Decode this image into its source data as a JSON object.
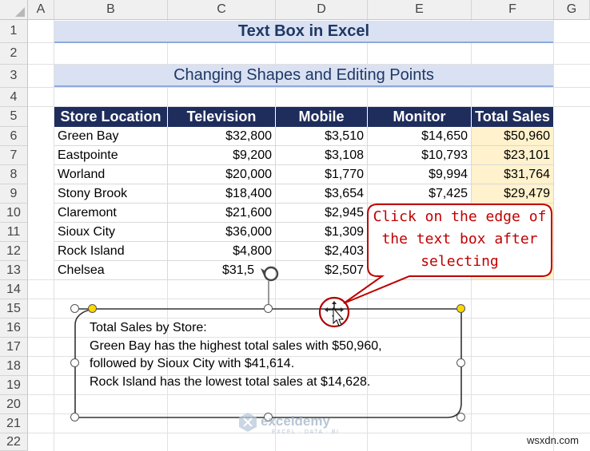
{
  "columns": [
    "A",
    "B",
    "C",
    "D",
    "E",
    "F",
    "G"
  ],
  "rows": [
    "1",
    "2",
    "3",
    "4",
    "5",
    "6",
    "7",
    "8",
    "9",
    "10",
    "11",
    "12",
    "13",
    "14",
    "15",
    "16",
    "17",
    "18",
    "19",
    "20",
    "21",
    "22"
  ],
  "title": "Text Box in Excel",
  "subtitle": "Changing Shapes and Editing Points",
  "table": {
    "headers": [
      "Store Location",
      "Television",
      "Mobile",
      "Monitor",
      "Total Sales"
    ],
    "rows": [
      [
        "Green Bay",
        "$32,800",
        "$3,510",
        "$14,650",
        "$50,960"
      ],
      [
        "Eastpointe",
        "$9,200",
        "$3,108",
        "$10,793",
        "$23,101"
      ],
      [
        "Worland",
        "$20,000",
        "$1,770",
        "$9,994",
        "$31,764"
      ],
      [
        "Stony Brook",
        "$18,400",
        "$3,654",
        "$7,425",
        "$29,479"
      ],
      [
        "Claremont",
        "$21,600",
        "$2,945",
        "",
        ""
      ],
      [
        "Sioux City",
        "$36,000",
        "$1,309",
        "",
        ""
      ],
      [
        "Rock Island",
        "$4,800",
        "$2,403",
        "",
        ""
      ],
      [
        "Chelsea",
        "$31,5",
        "$2,507",
        "",
        ""
      ]
    ]
  },
  "callout": {
    "lines": [
      "Click on the edge of",
      "the text box after",
      "selecting"
    ],
    "color": "#c00000"
  },
  "textbox": {
    "lines": [
      "Total Sales by Store:",
      "Green Bay has the highest total sales with $50,960,",
      "followed by Sioux City with $41,614.",
      "Rock Island has the lowest total sales at $14,628."
    ]
  },
  "watermark": {
    "name": "exceldemy",
    "sub": "EXCEL · DATA · BI"
  },
  "site_credit": "wsxdn.com",
  "icons": [
    "rotate-handle-icon",
    "move-cursor-icon",
    "exceldemy-logo-icon"
  ],
  "colors": {
    "header_fill": "#1f2d5c",
    "banner_fill": "#d9e1f2",
    "total_fill": "#fff2cc"
  }
}
